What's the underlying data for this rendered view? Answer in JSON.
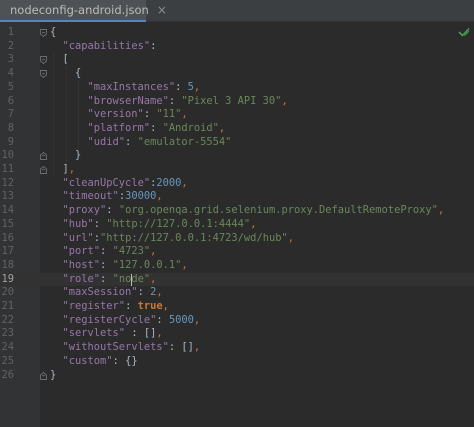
{
  "tab": {
    "filename": "nodeconfig-android.json",
    "close": "×"
  },
  "lines": [
    {
      "n": "1",
      "fold": "open",
      "indent": 0,
      "t": [
        [
          "b",
          "{"
        ]
      ]
    },
    {
      "n": "2",
      "fold": "",
      "indent": 1,
      "t": [
        [
          "k",
          "\"capabilities\""
        ],
        [
          "b",
          ":"
        ]
      ]
    },
    {
      "n": "3",
      "fold": "open",
      "indent": 1,
      "t": [
        [
          "b",
          "["
        ]
      ]
    },
    {
      "n": "4",
      "fold": "open",
      "indent": 2,
      "t": [
        [
          "b",
          "{"
        ]
      ]
    },
    {
      "n": "5",
      "fold": "",
      "indent": 3,
      "t": [
        [
          "k",
          "\"maxInstances\""
        ],
        [
          "b",
          ": "
        ],
        [
          "n",
          "5"
        ],
        [
          "p",
          ","
        ]
      ]
    },
    {
      "n": "6",
      "fold": "",
      "indent": 3,
      "t": [
        [
          "k",
          "\"browserName\""
        ],
        [
          "b",
          ": "
        ],
        [
          "s",
          "\"Pixel 3 API 30\""
        ],
        [
          "p",
          ","
        ]
      ]
    },
    {
      "n": "7",
      "fold": "",
      "indent": 3,
      "t": [
        [
          "k",
          "\"version\""
        ],
        [
          "b",
          ": "
        ],
        [
          "s",
          "\"11\""
        ],
        [
          "p",
          ","
        ]
      ]
    },
    {
      "n": "8",
      "fold": "",
      "indent": 3,
      "t": [
        [
          "k",
          "\"platform\""
        ],
        [
          "b",
          ": "
        ],
        [
          "s",
          "\"Android\""
        ],
        [
          "p",
          ","
        ]
      ]
    },
    {
      "n": "9",
      "fold": "",
      "indent": 3,
      "t": [
        [
          "k",
          "\"udid\""
        ],
        [
          "b",
          ": "
        ],
        [
          "s",
          "\"emulator-5554\""
        ]
      ]
    },
    {
      "n": "10",
      "fold": "close",
      "indent": 2,
      "t": [
        [
          "b",
          "}"
        ]
      ]
    },
    {
      "n": "11",
      "fold": "close",
      "indent": 1,
      "t": [
        [
          "b",
          "]"
        ],
        [
          "p",
          ","
        ]
      ]
    },
    {
      "n": "12",
      "fold": "",
      "indent": 1,
      "t": [
        [
          "k",
          "\"cleanUpCycle\""
        ],
        [
          "b",
          ":"
        ],
        [
          "n",
          "2000"
        ],
        [
          "p",
          ","
        ]
      ]
    },
    {
      "n": "13",
      "fold": "",
      "indent": 1,
      "t": [
        [
          "k",
          "\"timeout\""
        ],
        [
          "b",
          ":"
        ],
        [
          "n",
          "30000"
        ],
        [
          "p",
          ","
        ]
      ]
    },
    {
      "n": "14",
      "fold": "",
      "indent": 1,
      "t": [
        [
          "k",
          "\"proxy\""
        ],
        [
          "b",
          ": "
        ],
        [
          "s",
          "\"org.openqa.grid.selenium.proxy.DefaultRemoteProxy\""
        ],
        [
          "p",
          ","
        ]
      ]
    },
    {
      "n": "15",
      "fold": "",
      "indent": 1,
      "t": [
        [
          "k",
          "\"hub\""
        ],
        [
          "b",
          ": "
        ],
        [
          "s",
          "\"http://127.0.0.1:4444\""
        ],
        [
          "p",
          ","
        ]
      ]
    },
    {
      "n": "16",
      "fold": "",
      "indent": 1,
      "t": [
        [
          "k",
          "\"url\""
        ],
        [
          "b",
          ":"
        ],
        [
          "s",
          "\"http://127.0.0.1:4723/wd/hub\""
        ],
        [
          "p",
          ","
        ]
      ]
    },
    {
      "n": "17",
      "fold": "",
      "indent": 1,
      "t": [
        [
          "k",
          "\"port\""
        ],
        [
          "b",
          ": "
        ],
        [
          "s",
          "\"4723\""
        ],
        [
          "p",
          ","
        ]
      ]
    },
    {
      "n": "18",
      "fold": "",
      "indent": 1,
      "t": [
        [
          "k",
          "\"host\""
        ],
        [
          "b",
          ": "
        ],
        [
          "s",
          "\"127.0.0.1\""
        ],
        [
          "p",
          ","
        ]
      ]
    },
    {
      "n": "19",
      "fold": "",
      "indent": 1,
      "current": true,
      "t": [
        [
          "k",
          "\"role\""
        ],
        [
          "b",
          ": "
        ],
        [
          "s",
          "\"node\""
        ],
        [
          "p",
          ","
        ]
      ]
    },
    {
      "n": "20",
      "fold": "",
      "indent": 1,
      "t": [
        [
          "k",
          "\"maxSession\""
        ],
        [
          "b",
          ": "
        ],
        [
          "n",
          "2"
        ],
        [
          "p",
          ","
        ]
      ]
    },
    {
      "n": "21",
      "fold": "",
      "indent": 1,
      "t": [
        [
          "k",
          "\"register\""
        ],
        [
          "b",
          ": "
        ],
        [
          "kw",
          "true"
        ],
        [
          "p",
          ","
        ]
      ]
    },
    {
      "n": "22",
      "fold": "",
      "indent": 1,
      "t": [
        [
          "k",
          "\"registerCycle\""
        ],
        [
          "b",
          ": "
        ],
        [
          "n",
          "5000"
        ],
        [
          "p",
          ","
        ]
      ]
    },
    {
      "n": "23",
      "fold": "",
      "indent": 1,
      "t": [
        [
          "k",
          "\"servlets\""
        ],
        [
          "b",
          " : "
        ],
        [
          "b",
          "[]"
        ],
        [
          "p",
          ","
        ]
      ]
    },
    {
      "n": "24",
      "fold": "",
      "indent": 1,
      "t": [
        [
          "k",
          "\"withoutServlets\""
        ],
        [
          "b",
          ": "
        ],
        [
          "b",
          "[]"
        ],
        [
          "p",
          ","
        ]
      ]
    },
    {
      "n": "25",
      "fold": "",
      "indent": 1,
      "t": [
        [
          "k",
          "\"custom\""
        ],
        [
          "b",
          ": "
        ],
        [
          "b",
          "{}"
        ]
      ]
    },
    {
      "n": "26",
      "fold": "close",
      "indent": 0,
      "t": [
        [
          "b",
          "}"
        ]
      ]
    }
  ]
}
